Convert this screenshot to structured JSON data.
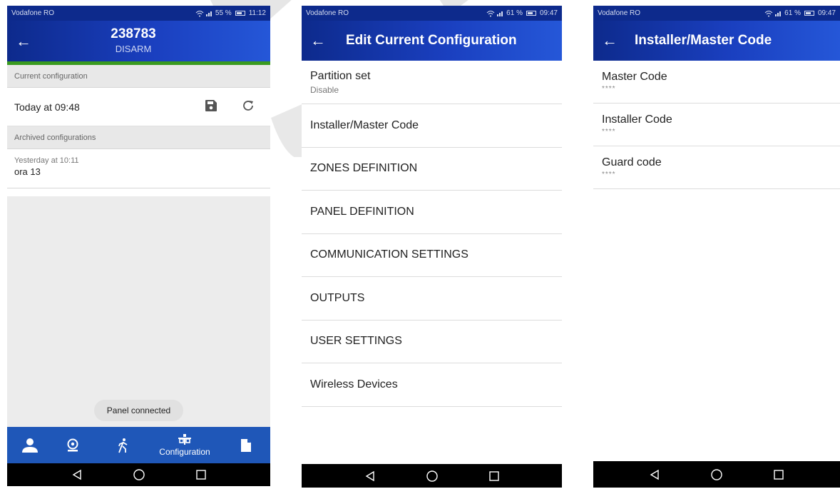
{
  "screens": [
    {
      "status": {
        "carrier": "Vodafone RO",
        "battery": "55 %",
        "time": "11:12"
      },
      "header": {
        "title": "238783",
        "subtitle": "DISARM"
      },
      "current": {
        "section_label": "Current configuration",
        "item_label": "Today at 09:48"
      },
      "archived": {
        "section_label": "Archived configurations",
        "items": [
          {
            "date": "Yesterday at 10:11",
            "name": "ora 13"
          }
        ]
      },
      "toast": "Panel connected",
      "bottom_nav": {
        "active_label": "Configuration"
      }
    },
    {
      "status": {
        "carrier": "Vodafone RO",
        "battery": "61 %",
        "time": "09:47"
      },
      "header": {
        "title": "Edit Current Configuration"
      },
      "menu": [
        {
          "label": "Partition set",
          "sub": "Disable"
        },
        {
          "label": "Installer/Master Code"
        },
        {
          "label": "ZONES DEFINITION"
        },
        {
          "label": "PANEL DEFINITION"
        },
        {
          "label": "COMMUNICATION SETTINGS"
        },
        {
          "label": "OUTPUTS"
        },
        {
          "label": "USER SETTINGS"
        },
        {
          "label": "Wireless Devices"
        }
      ]
    },
    {
      "status": {
        "carrier": "Vodafone RO",
        "battery": "61 %",
        "time": "09:47"
      },
      "header": {
        "title": "Installer/Master Code"
      },
      "codes": [
        {
          "label": "Master Code",
          "value": "****"
        },
        {
          "label": "Installer Code",
          "value": "****"
        },
        {
          "label": "Guard code",
          "value": "****"
        }
      ]
    }
  ],
  "colors": {
    "appbar": "#0d2a8c",
    "accent_green": "#3a9a1f",
    "bottom_nav": "#1f57b8"
  },
  "icons": [
    "back-arrow-icon",
    "save-icon",
    "refresh-icon",
    "user-icon",
    "camera-icon",
    "walk-icon",
    "configuration-icon",
    "document-icon",
    "android-back-icon",
    "android-home-icon",
    "android-recents-icon",
    "wifi-icon",
    "signal-icon",
    "battery-icon"
  ]
}
